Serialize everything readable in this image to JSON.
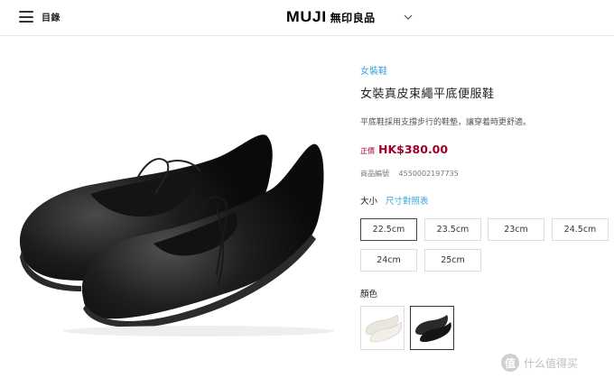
{
  "header": {
    "menu_label": "目錄",
    "logo_latin": "MUJI",
    "logo_cjk": "無印良品"
  },
  "product": {
    "category": "女裝鞋",
    "title": "女裝真皮束繩平底便服鞋",
    "description": "平底鞋採用支撐步行的鞋墊，讓穿着時更舒適。",
    "price_label": "正價",
    "price": "HK$380.00",
    "sku_label": "商品編號",
    "sku": "4550002197735"
  },
  "size": {
    "label": "大小",
    "chart_link": "尺寸對照表",
    "options": [
      "22.5cm",
      "23.5cm",
      "23cm",
      "24.5cm",
      "24cm",
      "25cm"
    ],
    "selected": "22.5cm"
  },
  "color": {
    "label": "顏色",
    "swatches": [
      "white",
      "black"
    ],
    "selected": "black"
  },
  "watermark": {
    "icon_text": "值",
    "text": "什么值得买"
  },
  "colors": {
    "accent_blue": "#3aa3d6",
    "price_red": "#a0002a"
  }
}
